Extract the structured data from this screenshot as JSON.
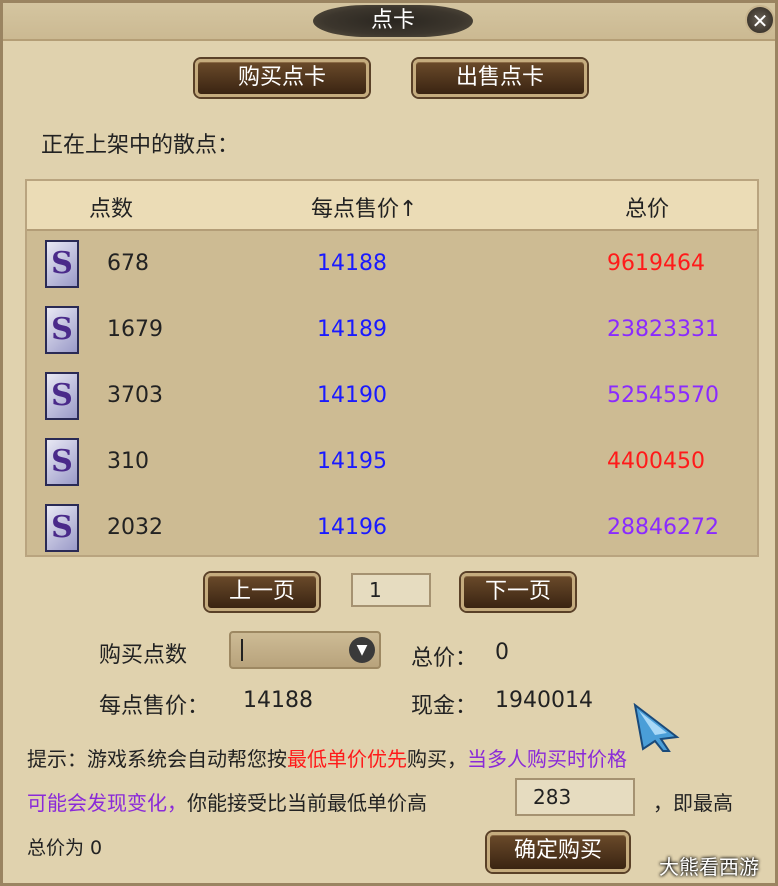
{
  "window": {
    "title": "点卡",
    "close_glyph": "✕"
  },
  "tabs": {
    "buy_label": "购买点卡",
    "sell_label": "出售点卡"
  },
  "listing_label": "正在上架中的散点：",
  "table": {
    "headers": [
      "点数",
      "每点售价↑",
      "总价"
    ],
    "rows": [
      {
        "points": "678",
        "unit_price": "14188",
        "total": "9619464",
        "total_color": "red"
      },
      {
        "points": "1679",
        "unit_price": "14189",
        "total": "23823331",
        "total_color": "purple"
      },
      {
        "points": "3703",
        "unit_price": "14190",
        "total": "52545570",
        "total_color": "purple"
      },
      {
        "points": "310",
        "unit_price": "14195",
        "total": "4400450",
        "total_color": "red"
      },
      {
        "points": "2032",
        "unit_price": "14196",
        "total": "28846272",
        "total_color": "purple"
      }
    ]
  },
  "pager": {
    "prev_label": "上一页",
    "page": "1",
    "next_label": "下一页"
  },
  "purchase": {
    "qty_label": "购买点数",
    "qty_value": "",
    "total_label": "总价：",
    "total_value": "0",
    "unit_label": "每点售价：",
    "unit_value": "14188",
    "cash_label": "现金：",
    "cash_value": "1940014"
  },
  "tip": {
    "part1": "提示：游戏系统会自动帮您按",
    "part2_red": "最低单价优先",
    "part3": "购买，",
    "part4_purple": "当多人购买时价格",
    "line2_purple": "可能会发现变化，",
    "line2_rest": "你能接受比当前最低单价高",
    "tolerance_value": "283",
    "line2_end": "，即最高",
    "line3": "总价为 0"
  },
  "confirm_label": "确定购买",
  "watermark": "大熊看西游",
  "colors": {
    "price_blue": "#1a1aff",
    "red": "#ff1a1a",
    "purple": "#8a2aff"
  }
}
